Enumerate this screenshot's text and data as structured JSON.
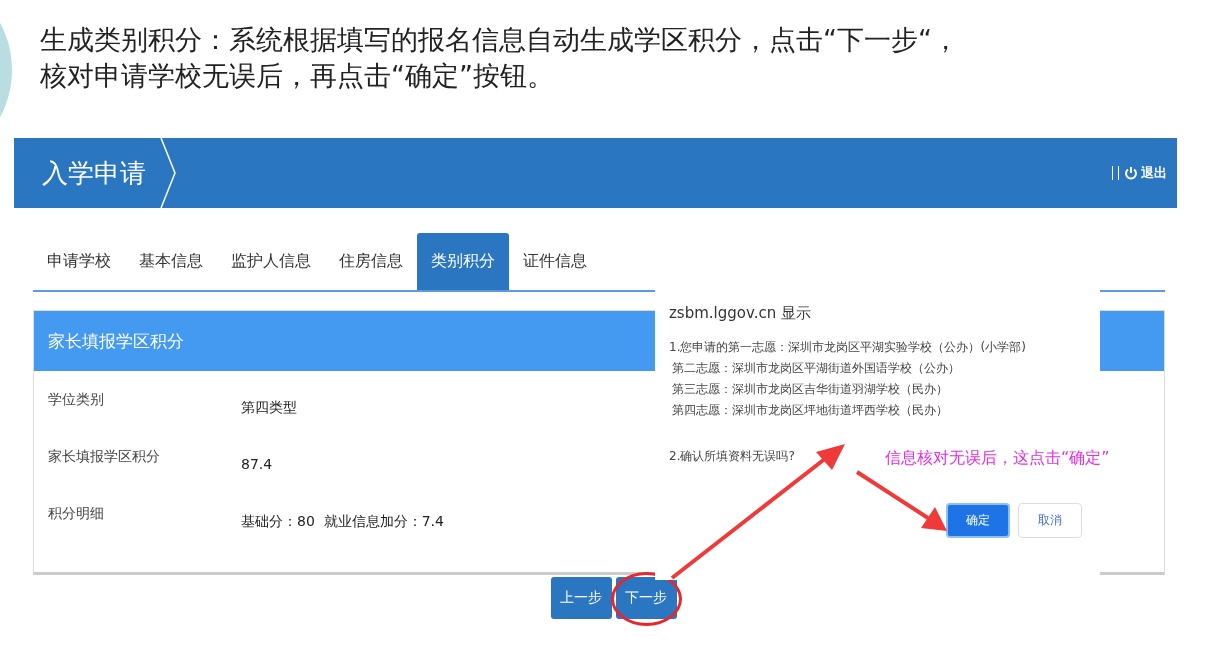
{
  "slide": {
    "instruction_lines": [
      "生成类别积分：系统根据填写的报名信息自动生成学区积分，点击“下一步“，",
      "核对申请学校无误后，再点击“确定”按钮。"
    ]
  },
  "app": {
    "title": "入学申请",
    "logout": "退出",
    "tabs": [
      {
        "label": "申请学校",
        "selected": false
      },
      {
        "label": "基本信息",
        "selected": false
      },
      {
        "label": "监护人信息",
        "selected": false
      },
      {
        "label": "住房信息",
        "selected": false
      },
      {
        "label": "类别积分",
        "selected": true
      },
      {
        "label": "证件信息",
        "selected": false
      }
    ],
    "panel": {
      "title": "家长填报学区积分",
      "fields": [
        {
          "label": "学位类别",
          "value": "第四类型"
        },
        {
          "label": "家长填报学区积分",
          "value": "87.4"
        },
        {
          "label": "积分明细",
          "value": "基础分：80  就业信息加分：7.4"
        }
      ]
    },
    "buttons": [
      {
        "label": "上一步",
        "highlighted": false
      },
      {
        "label": "下一步",
        "highlighted": true
      }
    ]
  },
  "dialog": {
    "title": "zsbm.lggov.cn 显示",
    "lines": [
      "1.您申请的第一志愿：深圳市龙岗区平湖实验学校（公办）(小学部)",
      "第二志愿：深圳市龙岗区平湖街道外国语学校（公办）",
      "第三志愿：深圳市龙岗区吉华街道羽湖学校（民办）",
      "第四志愿：深圳市龙岗区坪地街道坪西学校（民办）"
    ],
    "question": "2.确认所填资料无误吗?",
    "buttons": [
      {
        "label": "确定",
        "kind": "primary"
      },
      {
        "label": "取消",
        "kind": "secondary"
      }
    ]
  },
  "annotation": {
    "text": "信息核对无误后，这点击“确定”"
  }
}
